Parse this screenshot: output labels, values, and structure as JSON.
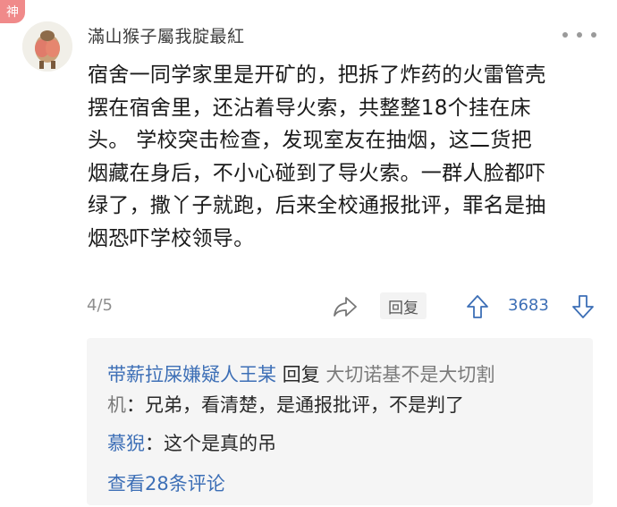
{
  "comment": {
    "badge": "神",
    "username": "滿山猴子屬我腚最紅",
    "body_lines": [
      "宿舍一同学家里是开矿的，把拆了炸药的火雷管壳",
      "摆在宿舍里，还沾着导火索，共整整18个挂在床",
      "头。 学校突击检查，发现室友在抽烟，这二货把",
      "烟藏在身后，不小心碰到了导火索。一群人脸都吓",
      "绿了，撒丫子就跑，后来全校通报批评，罪名是抽",
      "烟恐吓学校领导。"
    ],
    "page_indicator": "4/5",
    "reply_label": "回复",
    "vote_count": "3683"
  },
  "replies": [
    {
      "author": "带薪拉屎嫌疑人王某",
      "action": "回复",
      "target": "大切诺基不是大切割",
      "target_line2": "机",
      "text": "：兄弟，看清楚，是通报批评，不是判了"
    },
    {
      "author": "慕猊",
      "text": "：这个是真的吊"
    }
  ],
  "view_more": "查看28条评论",
  "icons": {
    "more": "more-dots-icon",
    "share": "share-icon",
    "upvote": "upvote-arrow-icon",
    "downvote": "downvote-arrow-icon"
  },
  "colors": {
    "accent": "#3d6fb6",
    "badge": "#f08a8a",
    "muted": "#8e8e8e"
  }
}
